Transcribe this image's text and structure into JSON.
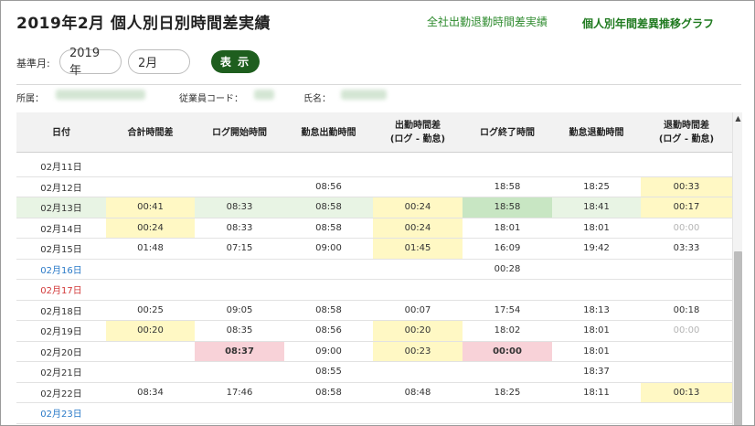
{
  "header": {
    "title": "2019年2月 個人別日別時間差実績",
    "link_company": "全社出勤退勤時間差実績",
    "link_graph": "個人別年間差異推移グラフ"
  },
  "filter": {
    "base_label": "基準月:",
    "year": "2019年",
    "month": "2月",
    "show_button": "表 示"
  },
  "info": {
    "affiliation_label": "所属：",
    "employee_code_label": "従業員コード：",
    "name_label": "氏名："
  },
  "table": {
    "columns": [
      [
        "日付"
      ],
      [
        "合計時間差"
      ],
      [
        "ログ開始時間"
      ],
      [
        "勤怠出勤時間"
      ],
      [
        "出勤時間差",
        "(ログ - 勤怠)"
      ],
      [
        "ログ終了時間"
      ],
      [
        "勤怠退勤時間"
      ],
      [
        "退勤時間差",
        "(ログ - 勤怠)"
      ]
    ],
    "rows": [
      {
        "date": "02月11日",
        "cells": [
          "",
          "",
          "",
          "",
          "",
          "",
          ""
        ]
      },
      {
        "date": "02月12日",
        "cells": [
          "",
          "",
          "08:56",
          "",
          "18:58",
          "18:25",
          "00:33"
        ]
      },
      {
        "date": "02月13日",
        "cells": [
          "00:41",
          "08:33",
          "08:58",
          "00:24",
          "18:58",
          "18:41",
          "00:17"
        ]
      },
      {
        "date": "02月14日",
        "cells": [
          "00:24",
          "08:33",
          "08:58",
          "00:24",
          "18:01",
          "18:01",
          "00:00"
        ]
      },
      {
        "date": "02月15日",
        "cells": [
          "01:48",
          "07:15",
          "09:00",
          "01:45",
          "16:09",
          "19:42",
          "03:33"
        ]
      },
      {
        "date": "02月16日",
        "cells": [
          "",
          "",
          "",
          "",
          "00:28",
          "",
          ""
        ]
      },
      {
        "date": "02月17日",
        "cells": [
          "",
          "",
          "",
          "",
          "",
          "",
          ""
        ]
      },
      {
        "date": "02月18日",
        "cells": [
          "00:25",
          "09:05",
          "08:58",
          "00:07",
          "17:54",
          "18:13",
          "00:18"
        ]
      },
      {
        "date": "02月19日",
        "cells": [
          "00:20",
          "08:35",
          "08:56",
          "00:20",
          "18:02",
          "18:01",
          "00:00"
        ]
      },
      {
        "date": "02月20日",
        "cells": [
          "",
          "08:37",
          "09:00",
          "00:23",
          "00:00",
          "18:01",
          ""
        ]
      },
      {
        "date": "02月21日",
        "cells": [
          "",
          "",
          "08:55",
          "",
          "",
          "18:37",
          ""
        ]
      },
      {
        "date": "02月22日",
        "cells": [
          "08:34",
          "17:46",
          "08:58",
          "08:48",
          "18:25",
          "18:11",
          "00:13"
        ]
      },
      {
        "date": "02月23日",
        "cells": [
          "",
          "",
          "",
          "",
          "",
          "",
          ""
        ]
      }
    ]
  },
  "colors": {
    "accent_green": "#1e5e1e",
    "highlight_yellow": "#fff8c4",
    "highlight_pink": "#f8d2d8",
    "highlight_green": "#c8e6c3",
    "row_selected": "#e8f4e4",
    "saturday_blue": "#2a7ac8",
    "sunday_red": "#d23a3a"
  }
}
